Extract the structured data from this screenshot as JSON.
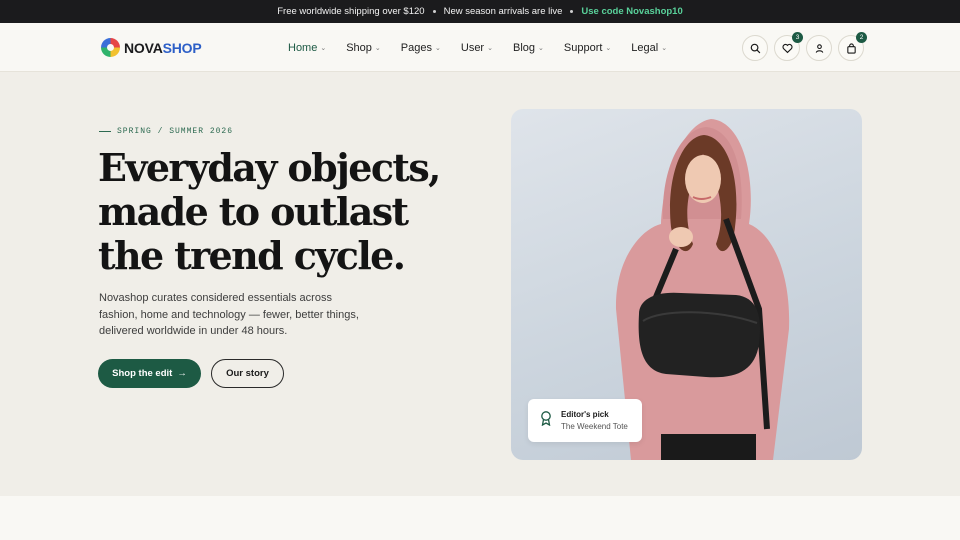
{
  "announcement": {
    "items": [
      "Free worldwide shipping over $120",
      "New season arrivals are live"
    ],
    "promo": "Use code Novashop10"
  },
  "brand": {
    "name_part1": "NOVA",
    "name_part2": "SHOP"
  },
  "nav": {
    "items": [
      {
        "label": "Home"
      },
      {
        "label": "Shop"
      },
      {
        "label": "Pages"
      },
      {
        "label": "User"
      },
      {
        "label": "Blog"
      },
      {
        "label": "Support"
      },
      {
        "label": "Legal"
      }
    ]
  },
  "header_icons": {
    "search": "search-icon",
    "wishlist": "heart-icon",
    "account": "user-icon",
    "cart": "bag-icon",
    "wishlist_count": "3",
    "cart_count": "2"
  },
  "hero": {
    "eyebrow": "SPRING / SUMMER 2026",
    "headline": [
      "Everyday objects,",
      "made to outlast",
      "the trend cycle."
    ],
    "description": [
      "Novashop curates considered essentials across",
      "fashion, home and technology — fewer, better things,",
      "delivered worldwide in under 48 hours."
    ],
    "primary_button": "Shop the edit",
    "primary_arrow": "→",
    "secondary_button": "Our story",
    "pick_title": "Editor's pick",
    "pick_product": "The Weekend Tote"
  },
  "colors": {
    "accent": "#1d5a44",
    "promo": "#59d19a",
    "topbar": "#1b1b1d",
    "hero_bg": "#f0eee8"
  }
}
